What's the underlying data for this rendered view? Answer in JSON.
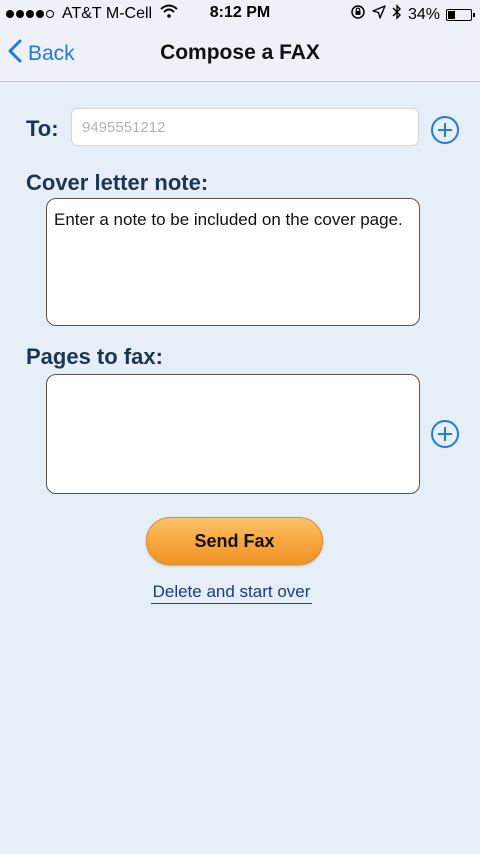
{
  "status_bar": {
    "carrier": "AT&T M-Cell",
    "time": "8:12 PM",
    "battery_percent": "34%",
    "battery_level": 0.34,
    "signal_bars_filled": 4,
    "signal_bars_total": 5,
    "icons": [
      "wifi-icon",
      "lock-rotation-icon",
      "location-arrow-icon",
      "bluetooth-icon",
      "battery-icon"
    ]
  },
  "nav": {
    "back_label": "Back",
    "title": "Compose a FAX"
  },
  "form": {
    "to_label": "To:",
    "to_placeholder": "9495551212",
    "to_value": "",
    "cover_label": "Cover letter note:",
    "cover_placeholder": "Enter a note to be included on the cover page.",
    "pages_label": "Pages to fax:"
  },
  "actions": {
    "send_label": "Send Fax",
    "delete_label": "Delete and start over"
  },
  "colors": {
    "accent": "#1f7be0",
    "label": "#1c3556",
    "background": "#e6eef8",
    "send_button": "#f7a53b",
    "link": "#1b3a8b"
  }
}
